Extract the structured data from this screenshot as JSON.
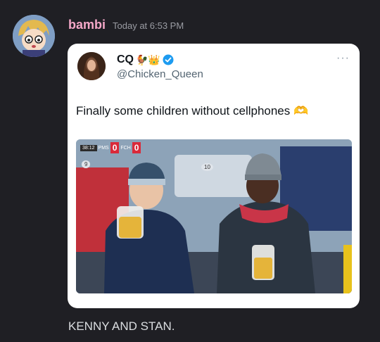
{
  "message": {
    "author": "bambi",
    "timestamp": "Today at 6:53 PM",
    "text": "KENNY AND STAN."
  },
  "tweet": {
    "display_name": "CQ",
    "display_emojis": "🐓👑",
    "verified_icon": "verified-check-icon",
    "handle": "@Chicken_Queen",
    "more_label": "···",
    "text": "Finally some children without cellphones",
    "text_emoji": "🫶",
    "photo": {
      "clock": "38:12",
      "team_home": "PMS",
      "team_away": "FCH",
      "score_home": "0",
      "score_away": "0",
      "seat_left": "9",
      "seat_right": "10"
    }
  },
  "colors": {
    "background": "#1f1f24",
    "author": "#f5a8c8",
    "verified": "#1d9bf0",
    "card": "#ffffff"
  }
}
